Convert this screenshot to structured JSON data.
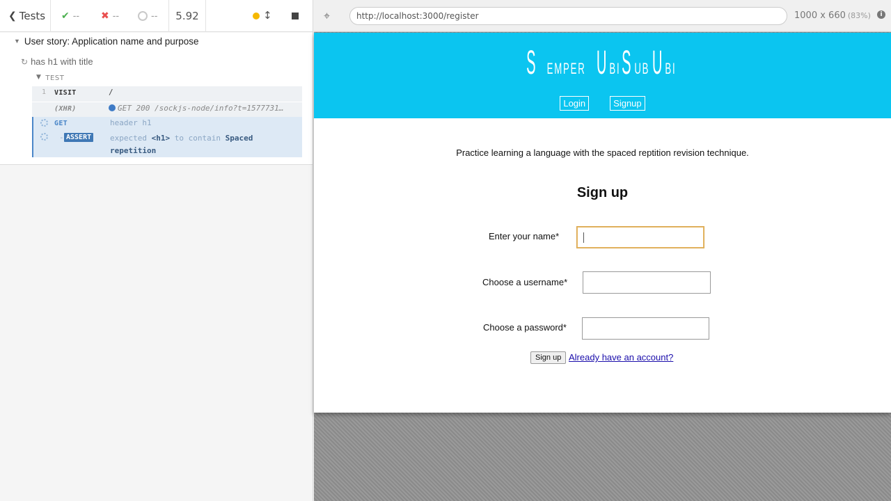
{
  "reporter": {
    "tests_label": "Tests",
    "passed": "--",
    "failed": "--",
    "pending": "--",
    "duration": "5.92",
    "suite_title": "User story: Application name and purpose",
    "test_title": "has h1 with title",
    "section_label": "TEST",
    "commands": [
      {
        "num": "1",
        "name": "VISIT",
        "message": "/"
      },
      {
        "num": "",
        "name": "(XHR)",
        "message": "GET 200 /sockjs-node/info?t=1577731…"
      },
      {
        "num": "",
        "name": "GET",
        "message": "header h1"
      },
      {
        "num": "",
        "name": "ASSERT",
        "dash": "-",
        "message_pre": "expected",
        "message_el": "<h1>",
        "message_mid": "to contain",
        "message_val": "Spaced repetition"
      }
    ]
  },
  "browser": {
    "url": "http://localhost:3000/register",
    "viewport": "1000 x 660",
    "scale": "(83%)"
  },
  "app": {
    "logo": "SemperUbiSubUbi",
    "nav": [
      "Login",
      "Signup"
    ],
    "tagline": "Practice learning a language with the spaced reptition revision technique.",
    "form_title": "Sign up",
    "fields": [
      {
        "label": "Enter your name*",
        "value": ""
      },
      {
        "label": "Choose a username*",
        "value": ""
      },
      {
        "label": "Choose a password*",
        "value": ""
      }
    ],
    "submit_label": "Sign up",
    "already_link": "Already have an account?"
  },
  "colors": {
    "header_bg": "#0bc5f0",
    "pass": "#4cb050",
    "fail": "#e94f4f",
    "running": "#f5b800",
    "assert_badge": "#3f78b5"
  }
}
